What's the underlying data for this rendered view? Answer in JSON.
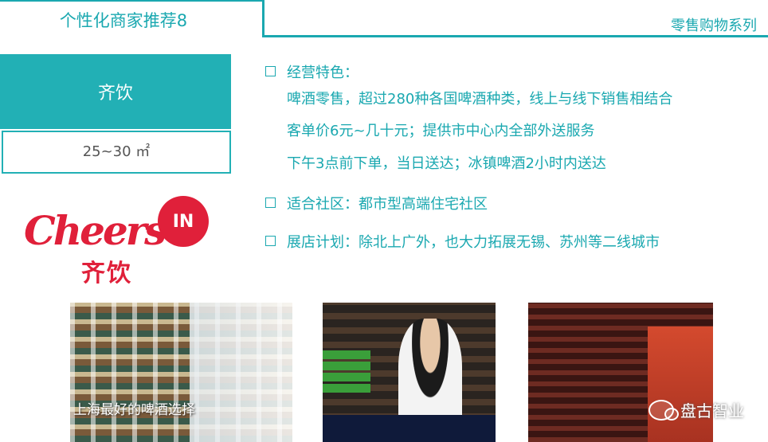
{
  "header": {
    "title": "个性化商家推荐8",
    "series": "零售购物系列"
  },
  "store": {
    "name": "齐饮",
    "area": "25~30 ㎡",
    "logo_text_en": "Cheers IN",
    "logo_text_cn": "齐饮"
  },
  "features": {
    "heading": "经营特色：",
    "lines": [
      "啤酒零售，超过280种各国啤酒种类，线上与线下销售相结合",
      "客单价6元~几十元；提供市中心内全部外送服务",
      "下午3点前下单，当日送达；冰镇啤酒2小时内送达"
    ]
  },
  "community": "适合社区：都市型高端住宅社区",
  "expansion": "展店计划：除北上广外，也大力拓展无锡、苏州等二线城市",
  "photos": {
    "caption1": "上海最好的啤酒选择"
  },
  "watermark": "盘古智业",
  "colors": {
    "accent": "#1aa8b0",
    "brand_box": "#22b0b5",
    "logo_red": "#e0203a"
  }
}
